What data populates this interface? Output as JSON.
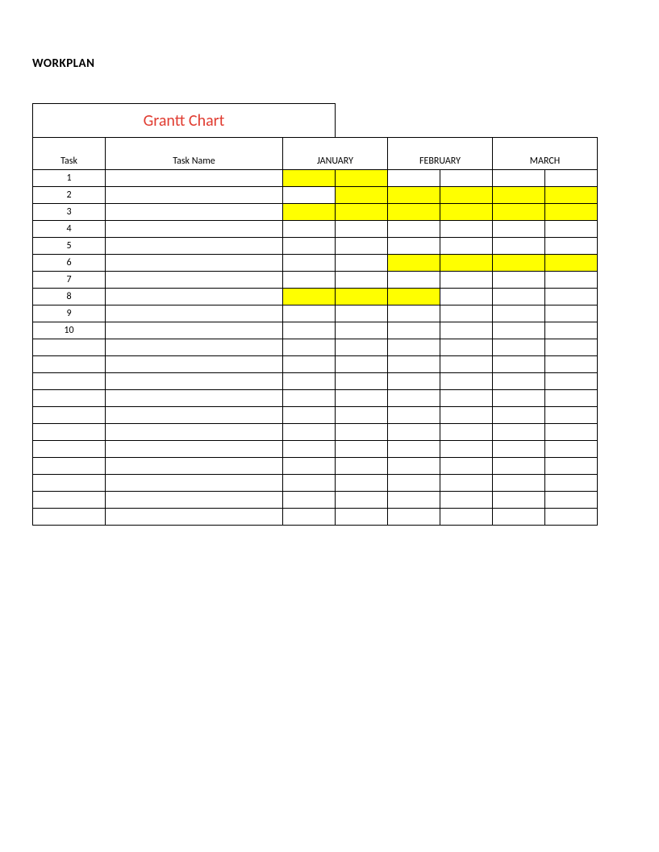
{
  "doc_title": "WORKPLAN",
  "chart_title": "Grantt Chart",
  "headers": {
    "task": "Task",
    "task_name": "Task Name",
    "months": [
      "JANUARY",
      "FEBRUARY",
      "MARCH"
    ]
  },
  "rows": [
    {
      "num": "1",
      "name": "",
      "cells": [
        true,
        true,
        false,
        false,
        false,
        false
      ]
    },
    {
      "num": "2",
      "name": "",
      "cells": [
        false,
        true,
        true,
        true,
        true,
        true
      ]
    },
    {
      "num": "3",
      "name": "",
      "cells": [
        true,
        true,
        true,
        true,
        true,
        true
      ]
    },
    {
      "num": "4",
      "name": "",
      "cells": [
        false,
        false,
        false,
        false,
        false,
        false
      ]
    },
    {
      "num": "5",
      "name": "",
      "cells": [
        false,
        false,
        false,
        false,
        false,
        false
      ]
    },
    {
      "num": "6",
      "name": "",
      "cells": [
        false,
        false,
        true,
        true,
        true,
        true
      ]
    },
    {
      "num": "7",
      "name": "",
      "cells": [
        false,
        false,
        false,
        false,
        false,
        false
      ]
    },
    {
      "num": "8",
      "name": "",
      "cells": [
        true,
        true,
        true,
        false,
        false,
        false
      ]
    },
    {
      "num": "9",
      "name": "",
      "cells": [
        false,
        false,
        false,
        false,
        false,
        false
      ]
    },
    {
      "num": "10",
      "name": "",
      "cells": [
        false,
        false,
        false,
        false,
        false,
        false
      ]
    },
    {
      "num": "",
      "name": "",
      "cells": [
        false,
        false,
        false,
        false,
        false,
        false
      ]
    },
    {
      "num": "",
      "name": "",
      "cells": [
        false,
        false,
        false,
        false,
        false,
        false
      ]
    },
    {
      "num": "",
      "name": "",
      "cells": [
        false,
        false,
        false,
        false,
        false,
        false
      ]
    },
    {
      "num": "",
      "name": "",
      "cells": [
        false,
        false,
        false,
        false,
        false,
        false
      ]
    },
    {
      "num": "",
      "name": "",
      "cells": [
        false,
        false,
        false,
        false,
        false,
        false
      ]
    },
    {
      "num": "",
      "name": "",
      "cells": [
        false,
        false,
        false,
        false,
        false,
        false
      ]
    },
    {
      "num": "",
      "name": "",
      "cells": [
        false,
        false,
        false,
        false,
        false,
        false
      ]
    },
    {
      "num": "",
      "name": "",
      "cells": [
        false,
        false,
        false,
        false,
        false,
        false
      ]
    },
    {
      "num": "",
      "name": "",
      "cells": [
        false,
        false,
        false,
        false,
        false,
        false
      ]
    },
    {
      "num": "",
      "name": "",
      "cells": [
        false,
        false,
        false,
        false,
        false,
        false
      ]
    },
    {
      "num": "",
      "name": "",
      "cells": [
        false,
        false,
        false,
        false,
        false,
        false
      ]
    }
  ],
  "chart_data": {
    "type": "bar",
    "title": "Grantt Chart",
    "xlabel": "",
    "ylabel": "Task",
    "categories": [
      "JANUARY-1",
      "JANUARY-2",
      "FEBRUARY-1",
      "FEBRUARY-2",
      "MARCH-1",
      "MARCH-2"
    ],
    "series": [
      {
        "name": "1",
        "values": [
          1,
          1,
          0,
          0,
          0,
          0
        ]
      },
      {
        "name": "2",
        "values": [
          0,
          1,
          1,
          1,
          1,
          1
        ]
      },
      {
        "name": "3",
        "values": [
          1,
          1,
          1,
          1,
          1,
          1
        ]
      },
      {
        "name": "4",
        "values": [
          0,
          0,
          0,
          0,
          0,
          0
        ]
      },
      {
        "name": "5",
        "values": [
          0,
          0,
          0,
          0,
          0,
          0
        ]
      },
      {
        "name": "6",
        "values": [
          0,
          0,
          1,
          1,
          1,
          1
        ]
      },
      {
        "name": "7",
        "values": [
          0,
          0,
          0,
          0,
          0,
          0
        ]
      },
      {
        "name": "8",
        "values": [
          1,
          1,
          1,
          0,
          0,
          0
        ]
      },
      {
        "name": "9",
        "values": [
          0,
          0,
          0,
          0,
          0,
          0
        ]
      },
      {
        "name": "10",
        "values": [
          0,
          0,
          0,
          0,
          0,
          0
        ]
      }
    ]
  }
}
